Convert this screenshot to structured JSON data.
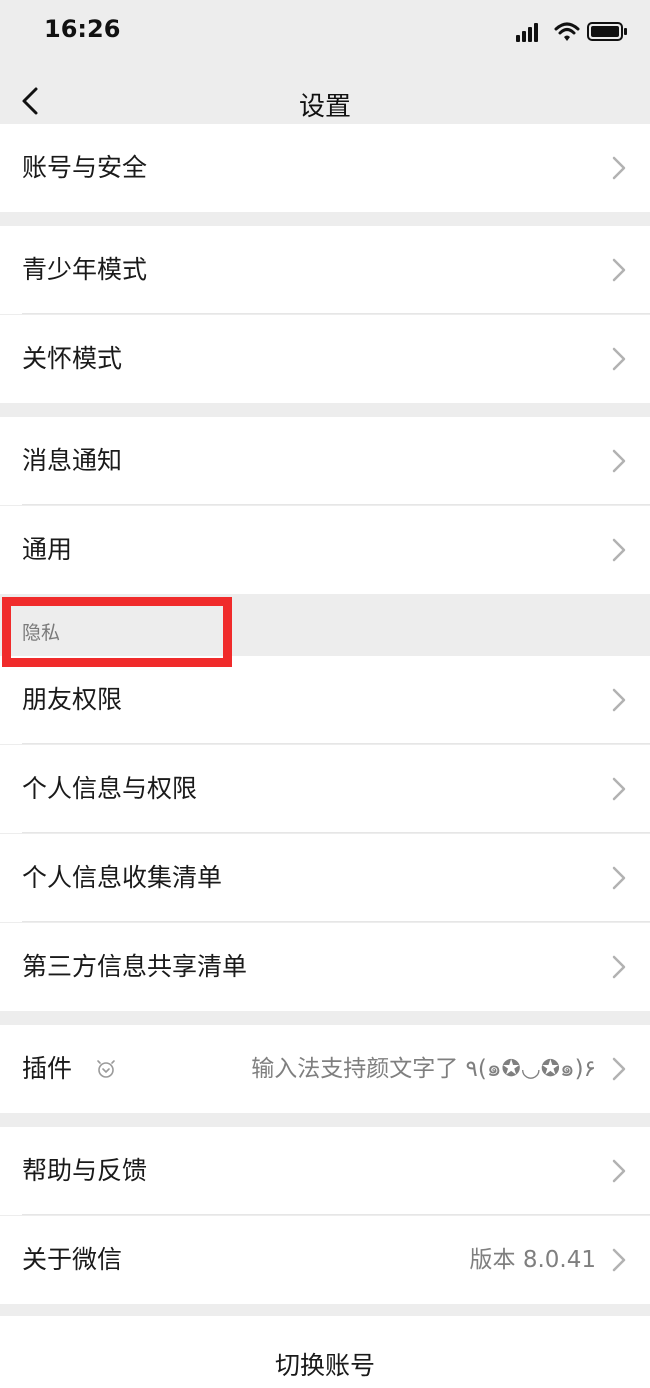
{
  "status_bar": {
    "time": "16:26"
  },
  "nav": {
    "title": "设置"
  },
  "rows": {
    "account_security": {
      "label": "账号与安全"
    },
    "teen_mode": {
      "label": "青少年模式"
    },
    "care_mode": {
      "label": "关怀模式"
    },
    "notifications": {
      "label": "消息通知"
    },
    "general": {
      "label": "通用"
    },
    "friend_permissions": {
      "label": "朋友权限"
    },
    "personal_info_permissions": {
      "label": "个人信息与权限"
    },
    "personal_info_collection": {
      "label": "个人信息收集清单"
    },
    "third_party_sharing": {
      "label": "第三方信息共享清单"
    },
    "plugins": {
      "label": "插件",
      "value": "输入法支持颜文字了 ٩(๑✪◡✪๑)۶"
    },
    "help_feedback": {
      "label": "帮助与反馈"
    },
    "about_wechat": {
      "label": "关于微信",
      "value": "版本 8.0.41"
    }
  },
  "sections": {
    "privacy": "隐私"
  },
  "footer": {
    "switch_account": "切换账号"
  },
  "colors": {
    "highlight": "#f02b2b",
    "background": "#ededed",
    "row": "#ffffff"
  },
  "icons": [
    "back-arrow-icon",
    "signal-icon",
    "wifi-icon",
    "battery-icon",
    "chevron-right-icon",
    "plugin-bulb-icon"
  ]
}
